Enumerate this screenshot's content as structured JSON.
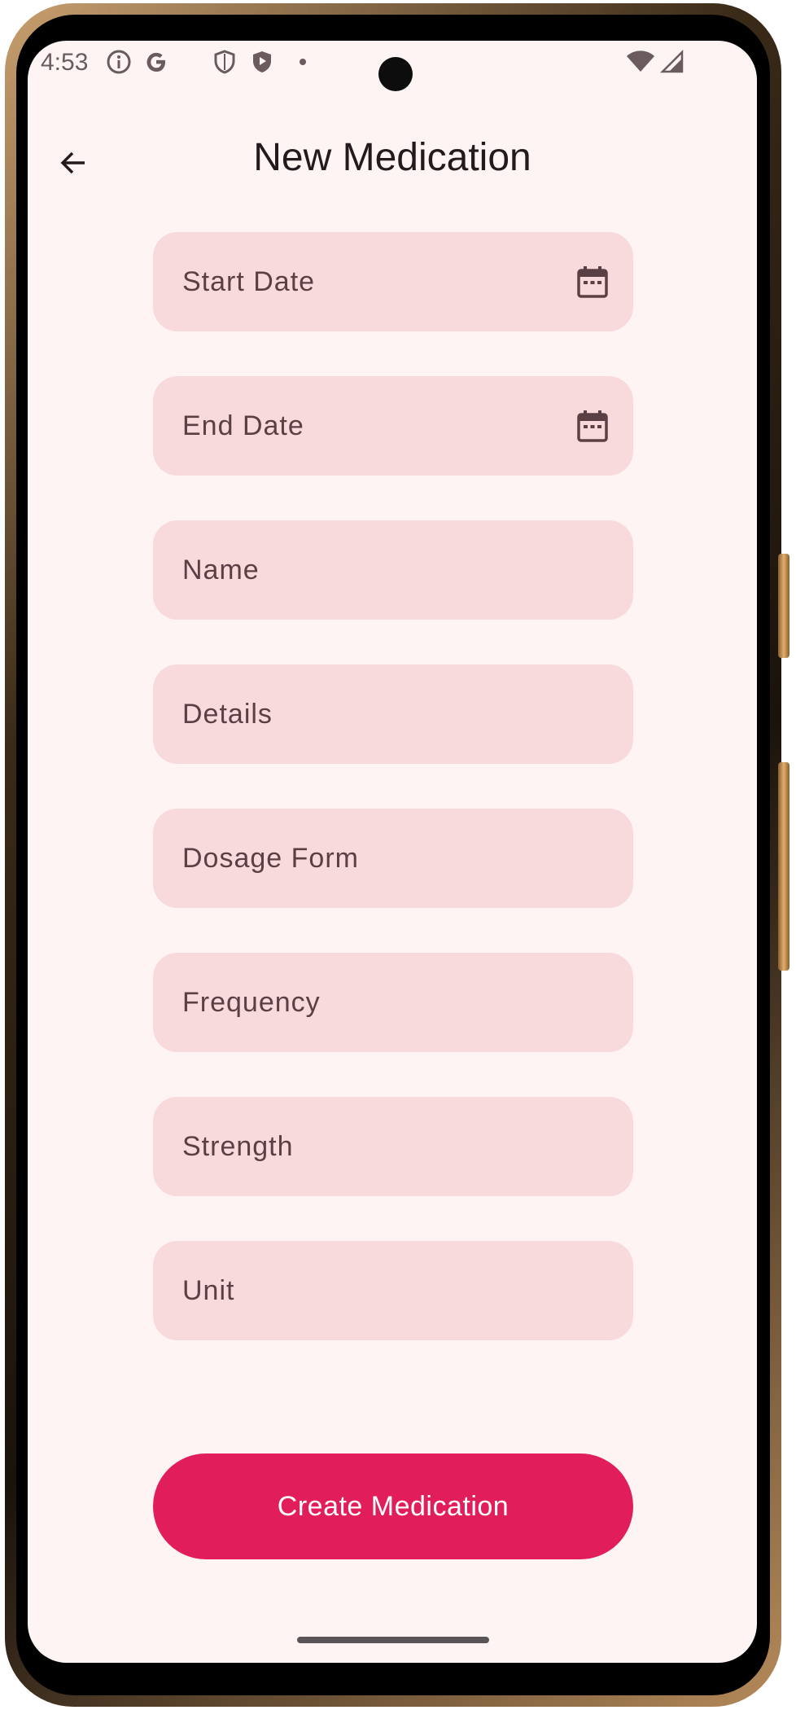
{
  "status_bar": {
    "time": "4:53",
    "icons": [
      "info-icon",
      "google-icon",
      "shield-icon",
      "play-protect-icon",
      "dot-icon",
      "wifi-icon",
      "signal-icon"
    ]
  },
  "header": {
    "title": "New Medication",
    "back_icon": "arrow-back-icon"
  },
  "form": {
    "fields": [
      {
        "label": "Start Date",
        "icon": "calendar-icon"
      },
      {
        "label": "End Date",
        "icon": "calendar-icon"
      },
      {
        "label": "Name"
      },
      {
        "label": "Details"
      },
      {
        "label": "Dosage Form"
      },
      {
        "label": "Frequency"
      },
      {
        "label": "Strength"
      },
      {
        "label": "Unit"
      }
    ],
    "submit_label": "Create Medication"
  },
  "colors": {
    "background": "#fdf4f3",
    "field_fill": "#f8dadd",
    "accent": "#e21e5a",
    "text_primary": "#221a1c",
    "text_label": "#5a3f45"
  }
}
